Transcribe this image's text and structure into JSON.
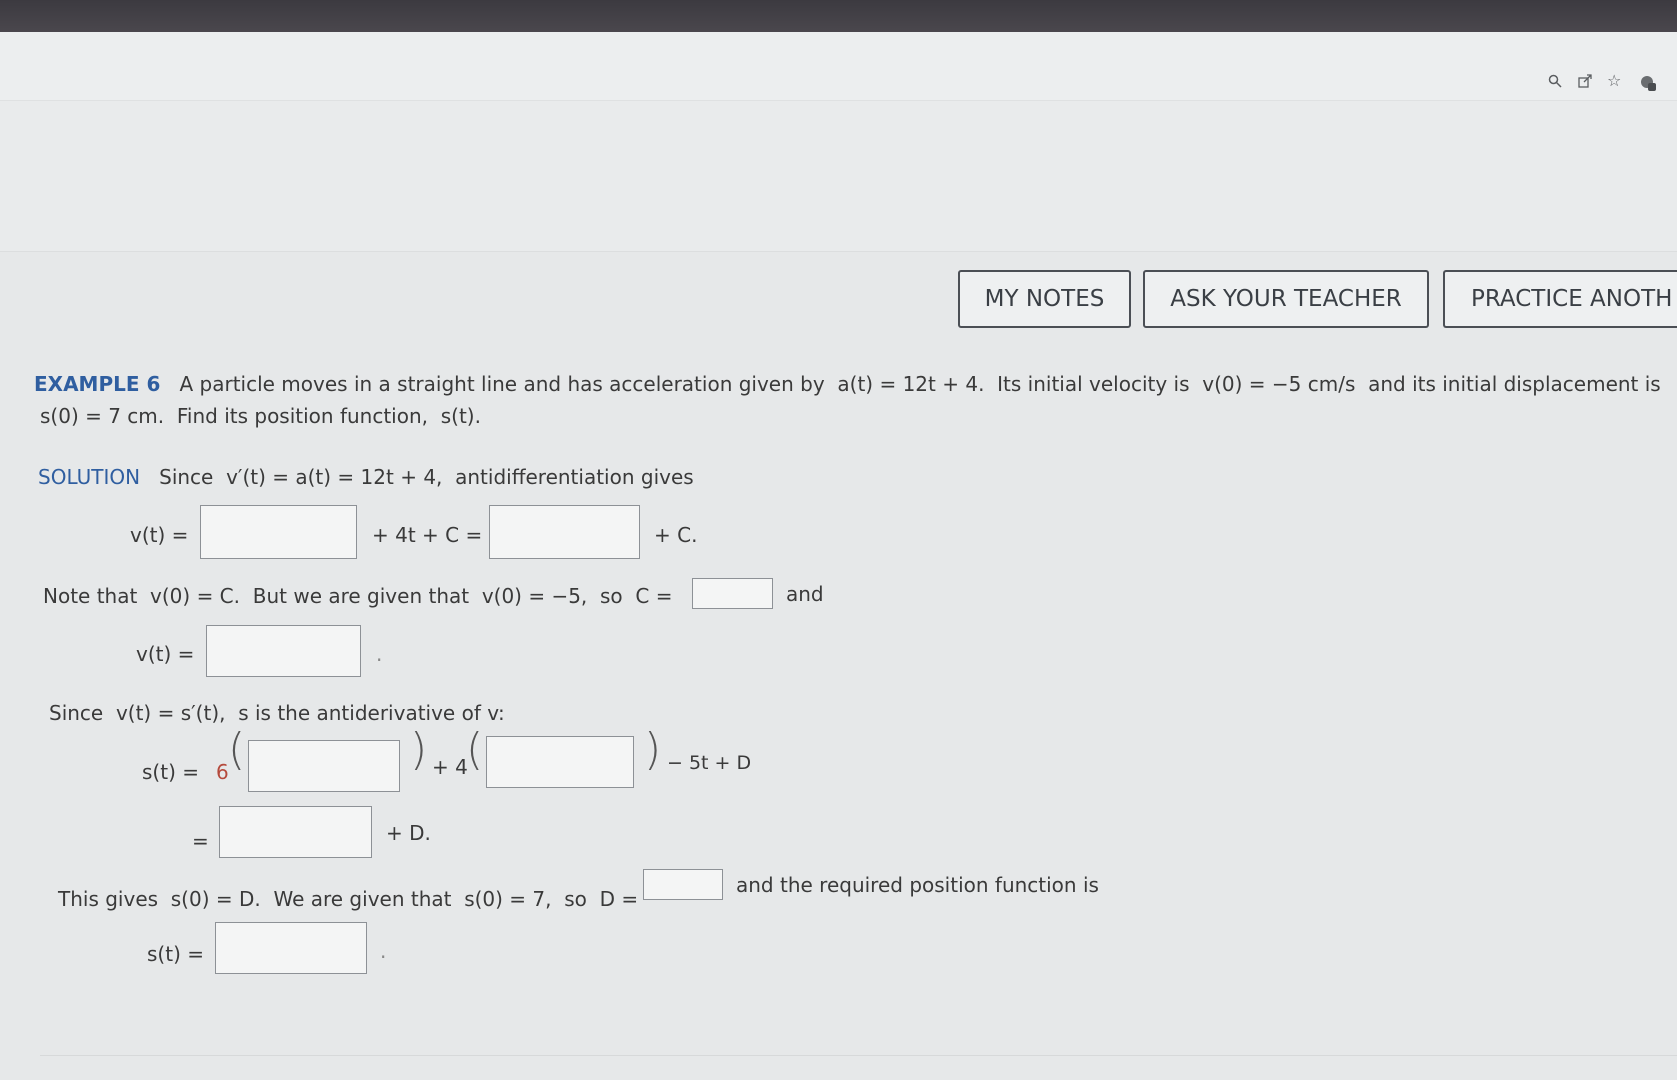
{
  "toolbar": {
    "icons": [
      "zoom-icon",
      "share-icon",
      "star-icon",
      "extension-icon"
    ],
    "buttons": {
      "my_notes": "MY NOTES",
      "ask_teacher": "ASK YOUR TEACHER",
      "practice": "PRACTICE ANOTH"
    }
  },
  "example": {
    "label": "EXAMPLE 6",
    "text_1": "A particle moves in a straight line and has acceleration given by",
    "accel": "a(t) = 12t + 4.",
    "text_2": "Its initial velocity is",
    "v0": "v(0) = −5 cm/s",
    "text_3": "and its initial displacement is",
    "s0": "s(0) = 7 cm.",
    "text_4": "Find its position function,",
    "s_t": "s(t)."
  },
  "solution": {
    "label": "SOLUTION",
    "since_1": "Since",
    "since_expr": "v′(t) = a(t) = 12t + 4,",
    "since_tail": "antidifferentiation gives",
    "vt_label_1": "v(t) =",
    "mid_1": "+ 4t + C =",
    "end_1": "+ C.",
    "note_1": "Note that",
    "note_expr": "v(0) = C.",
    "note_2": "But we are given that",
    "note_expr2": "v(0) = −5,",
    "note_so": "so",
    "note_c": "C =",
    "note_and": "and",
    "vt_label_2": "v(t) =",
    "dot_1": ".",
    "since_2": "Since",
    "since_2_expr": "v(t) = s′(t),",
    "since_2_tail": "s is the antiderivative of v:",
    "st_label_1": "s(t) =",
    "coef_6": "6",
    "plus_4": "+ 4",
    "minus_5t": "− 5t + D",
    "eq": "=",
    "plus_d": "+ D.",
    "gives_1": "This gives",
    "gives_expr": "s(0) = D.",
    "gives_2": "We are given that",
    "gives_expr2": "s(0) = 7,",
    "gives_so": "so",
    "gives_d": "D =",
    "gives_tail": "and the required position function is",
    "st_label_2": "s(t) =",
    "dot_2": "."
  },
  "colors": {
    "accent_blue": "#2f5ea0",
    "number_red": "#b54a3c"
  }
}
